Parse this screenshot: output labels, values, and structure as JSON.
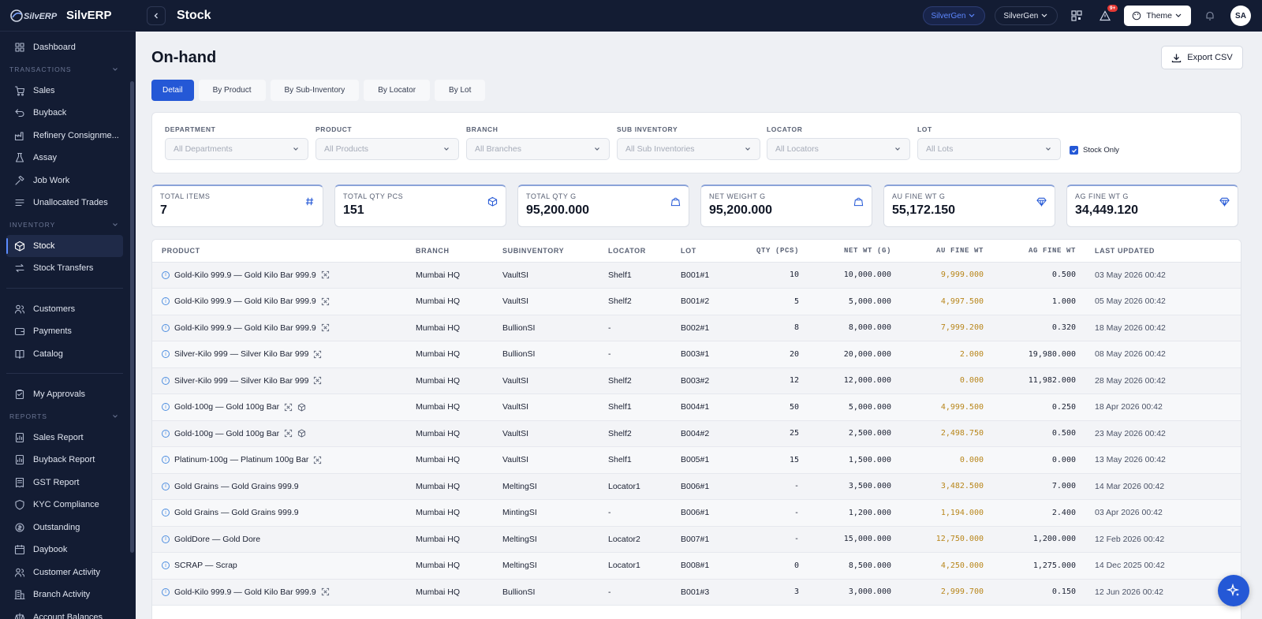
{
  "brand": {
    "logo_text": "SilvERP",
    "name": "SilvERP"
  },
  "sidebar": {
    "items": [
      {
        "label": "Dashboard",
        "icon": "grid-icon"
      },
      {
        "section": "TRANSACTIONS"
      },
      {
        "label": "Sales",
        "icon": "cart-icon"
      },
      {
        "label": "Buyback",
        "icon": "undo-icon"
      },
      {
        "label": "Refinery Consignme...",
        "icon": "factory-icon"
      },
      {
        "label": "Assay",
        "icon": "flask-icon"
      },
      {
        "label": "Job Work",
        "icon": "hammer-icon"
      },
      {
        "label": "Unallocated Trades",
        "icon": "list-icon"
      },
      {
        "section": "INVENTORY"
      },
      {
        "label": "Stock",
        "icon": "box-icon",
        "active": true
      },
      {
        "label": "Stock Transfers",
        "icon": "transfer-icon"
      },
      {
        "divider": true
      },
      {
        "label": "Customers",
        "icon": "users-icon"
      },
      {
        "label": "Payments",
        "icon": "wallet-icon"
      },
      {
        "label": "Catalog",
        "icon": "book-icon"
      },
      {
        "divider": true
      },
      {
        "label": "My Approvals",
        "icon": "clipboard-icon"
      },
      {
        "section": "REPORTS"
      },
      {
        "label": "Sales Report",
        "icon": "report-icon"
      },
      {
        "label": "Buyback Report",
        "icon": "report-icon"
      },
      {
        "label": "GST Report",
        "icon": "receipt-icon"
      },
      {
        "label": "KYC Compliance",
        "icon": "shield-icon"
      },
      {
        "label": "Outstanding",
        "icon": "coins-icon"
      },
      {
        "label": "Daybook",
        "icon": "calendar-icon"
      },
      {
        "label": "Customer Activity",
        "icon": "users-icon"
      },
      {
        "label": "Branch Activity",
        "icon": "building-icon"
      },
      {
        "label": "Account Balances",
        "icon": "scale-icon"
      }
    ]
  },
  "topbar": {
    "title": "Stock",
    "org_pill": "SilverGen",
    "tenant_pill": "SilverGen",
    "notif_badge": "9+",
    "theme_label": "Theme",
    "avatar_initials": "SA"
  },
  "page": {
    "title": "On-hand",
    "export_label": "Export CSV",
    "tabs": [
      "Detail",
      "By Product",
      "By Sub-Inventory",
      "By Locator",
      "By Lot"
    ]
  },
  "filters": [
    {
      "label": "DEPARTMENT",
      "placeholder": "All Departments"
    },
    {
      "label": "PRODUCT",
      "placeholder": "All Products"
    },
    {
      "label": "BRANCH",
      "placeholder": "All Branches"
    },
    {
      "label": "SUB INVENTORY",
      "placeholder": "All Sub Inventories"
    },
    {
      "label": "LOCATOR",
      "placeholder": "All Locators"
    },
    {
      "label": "LOT",
      "placeholder": "All Lots"
    }
  ],
  "stock_only_label": "Stock Only",
  "kpis": [
    {
      "label": "TOTAL ITEMS",
      "value": "7",
      "icon": "hash-icon"
    },
    {
      "label": "TOTAL QTY PCS",
      "value": "151",
      "icon": "cube-icon"
    },
    {
      "label": "TOTAL QTY G",
      "value": "95,200.000",
      "icon": "weight-icon"
    },
    {
      "label": "NET WEIGHT G",
      "value": "95,200.000",
      "icon": "weight-icon"
    },
    {
      "label": "AU FINE WT G",
      "value": "55,172.150",
      "icon": "diamond-icon"
    },
    {
      "label": "AG FINE WT G",
      "value": "34,449.120",
      "icon": "diamond-icon"
    }
  ],
  "table": {
    "headers": [
      "PRODUCT",
      "BRANCH",
      "SUBINVENTORY",
      "LOCATOR",
      "LOT",
      "QTY (PCS)",
      "NET WT (G)",
      "AU FINE WT",
      "AG FINE WT",
      "LAST UPDATED"
    ],
    "rows": [
      {
        "product": "Gold-Kilo 999.9 — Gold Kilo Bar 999.9",
        "tags": [
          "scan-icon"
        ],
        "branch": "Mumbai HQ",
        "sub": "VaultSI",
        "locator": "Shelf1",
        "lot": "B001#1",
        "qty": "10",
        "net": "10,000.000",
        "au": "9,999.000",
        "ag": "0.500",
        "updated": "03 May 2026 00:42"
      },
      {
        "product": "Gold-Kilo 999.9 — Gold Kilo Bar 999.9",
        "tags": [
          "scan-icon"
        ],
        "branch": "Mumbai HQ",
        "sub": "VaultSI",
        "locator": "Shelf2",
        "lot": "B001#2",
        "qty": "5",
        "net": "5,000.000",
        "au": "4,997.500",
        "ag": "1.000",
        "updated": "05 May 2026 00:42"
      },
      {
        "product": "Gold-Kilo 999.9 — Gold Kilo Bar 999.9",
        "tags": [
          "scan-icon"
        ],
        "branch": "Mumbai HQ",
        "sub": "BullionSI",
        "locator": "-",
        "lot": "B002#1",
        "qty": "8",
        "net": "8,000.000",
        "au": "7,999.200",
        "ag": "0.320",
        "updated": "18 May 2026 00:42"
      },
      {
        "product": "Silver-Kilo 999 — Silver Kilo Bar 999",
        "tags": [
          "scan-icon"
        ],
        "branch": "Mumbai HQ",
        "sub": "BullionSI",
        "locator": "-",
        "lot": "B003#1",
        "qty": "20",
        "net": "20,000.000",
        "au": "2.000",
        "ag": "19,980.000",
        "updated": "08 May 2026 00:42"
      },
      {
        "product": "Silver-Kilo 999 — Silver Kilo Bar 999",
        "tags": [
          "scan-icon"
        ],
        "branch": "Mumbai HQ",
        "sub": "VaultSI",
        "locator": "Shelf2",
        "lot": "B003#2",
        "qty": "12",
        "net": "12,000.000",
        "au": "0.000",
        "ag": "11,982.000",
        "updated": "28 May 2026 00:42"
      },
      {
        "product": "Gold-100g — Gold 100g Bar",
        "tags": [
          "scan-icon",
          "cube-icon"
        ],
        "branch": "Mumbai HQ",
        "sub": "VaultSI",
        "locator": "Shelf1",
        "lot": "B004#1",
        "qty": "50",
        "net": "5,000.000",
        "au": "4,999.500",
        "ag": "0.250",
        "updated": "18 Apr 2026 00:42"
      },
      {
        "product": "Gold-100g — Gold 100g Bar",
        "tags": [
          "scan-icon",
          "cube-icon"
        ],
        "branch": "Mumbai HQ",
        "sub": "VaultSI",
        "locator": "Shelf2",
        "lot": "B004#2",
        "qty": "25",
        "net": "2,500.000",
        "au": "2,498.750",
        "ag": "0.500",
        "updated": "23 May 2026 00:42"
      },
      {
        "product": "Platinum-100g — Platinum 100g Bar",
        "tags": [
          "scan-icon"
        ],
        "branch": "Mumbai HQ",
        "sub": "VaultSI",
        "locator": "Shelf1",
        "lot": "B005#1",
        "qty": "15",
        "net": "1,500.000",
        "au": "0.000",
        "ag": "0.000",
        "updated": "13 May 2026 00:42"
      },
      {
        "product": "Gold Grains — Gold Grains 999.9",
        "tags": [],
        "branch": "Mumbai HQ",
        "sub": "MeltingSI",
        "locator": "Locator1",
        "lot": "B006#1",
        "qty": "-",
        "net": "3,500.000",
        "au": "3,482.500",
        "ag": "7.000",
        "updated": "14 Mar 2026 00:42"
      },
      {
        "product": "Gold Grains — Gold Grains 999.9",
        "tags": [],
        "branch": "Mumbai HQ",
        "sub": "MintingSI",
        "locator": "-",
        "lot": "B006#1",
        "qty": "-",
        "net": "1,200.000",
        "au": "1,194.000",
        "ag": "2.400",
        "updated": "03 Apr 2026 00:42"
      },
      {
        "product": "GoldDore — Gold Dore",
        "tags": [],
        "branch": "Mumbai HQ",
        "sub": "MeltingSI",
        "locator": "Locator2",
        "lot": "B007#1",
        "qty": "-",
        "net": "15,000.000",
        "au": "12,750.000",
        "ag": "1,200.000",
        "updated": "12 Feb 2026 00:42"
      },
      {
        "product": "SCRAP — Scrap",
        "tags": [],
        "branch": "Mumbai HQ",
        "sub": "MeltingSI",
        "locator": "Locator1",
        "lot": "B008#1",
        "qty": "0",
        "net": "8,500.000",
        "au": "4,250.000",
        "ag": "1,275.000",
        "updated": "14 Dec 2025 00:42"
      },
      {
        "product": "Gold-Kilo 999.9 — Gold Kilo Bar 999.9",
        "tags": [
          "scan-icon"
        ],
        "branch": "Mumbai HQ",
        "sub": "BullionSI",
        "locator": "-",
        "lot": "B001#3",
        "qty": "3",
        "net": "3,000.000",
        "au": "2,999.700",
        "ag": "0.150",
        "updated": "12 Jun 2026 00:42"
      }
    ]
  },
  "colors": {
    "accent": "#2458d6",
    "sidebar_bg": "#131c33",
    "gold_text": "#b8861b"
  }
}
